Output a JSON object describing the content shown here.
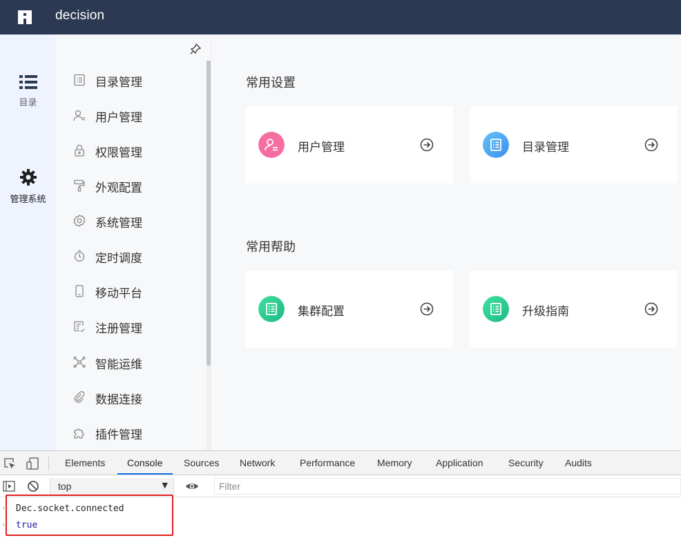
{
  "app": {
    "title": "decision"
  },
  "rail": {
    "items": [
      {
        "label": "目录",
        "icon": "list-icon"
      },
      {
        "label": "管理系统",
        "icon": "gear-icon"
      }
    ]
  },
  "submenu": {
    "items": [
      {
        "label": "目录管理",
        "icon": "catalog-icon"
      },
      {
        "label": "用户管理",
        "icon": "user-icon"
      },
      {
        "label": "权限管理",
        "icon": "lock-icon"
      },
      {
        "label": "外观配置",
        "icon": "paint-roller-icon"
      },
      {
        "label": "系统管理",
        "icon": "settings-icon"
      },
      {
        "label": "定时调度",
        "icon": "timer-icon"
      },
      {
        "label": "移动平台",
        "icon": "mobile-icon"
      },
      {
        "label": "注册管理",
        "icon": "register-icon"
      },
      {
        "label": "智能运维",
        "icon": "network-icon"
      },
      {
        "label": "数据连接",
        "icon": "link-icon"
      },
      {
        "label": "插件管理",
        "icon": "plugin-icon"
      }
    ]
  },
  "main": {
    "sections": [
      {
        "title": "常用设置",
        "cards": [
          {
            "label": "用户管理",
            "icon": "user-card-icon",
            "color": "#f56ea3"
          },
          {
            "label": "目录管理",
            "icon": "catalog-card-icon",
            "color": "#4fa8f0"
          }
        ]
      },
      {
        "title": "常用帮助",
        "cards": [
          {
            "label": "集群配置",
            "icon": "doc-card-icon",
            "color": "#2ecf95"
          },
          {
            "label": "升级指南",
            "icon": "doc-card-icon",
            "color": "#2ecf95"
          }
        ]
      }
    ]
  },
  "devtools": {
    "tabs": [
      "Elements",
      "Console",
      "Sources",
      "Network",
      "Performance",
      "Memory",
      "Application",
      "Security",
      "Audits"
    ],
    "active_tab": "Console",
    "context": "top",
    "filter_placeholder": "Filter",
    "console": [
      {
        "type": "input",
        "text": "Dec.socket.connected"
      },
      {
        "type": "output",
        "text": "true"
      }
    ],
    "colors": {
      "highlight": "#e11d1d",
      "boolean": "#1a1aa6",
      "tab_underline": "#1a73e8"
    }
  }
}
